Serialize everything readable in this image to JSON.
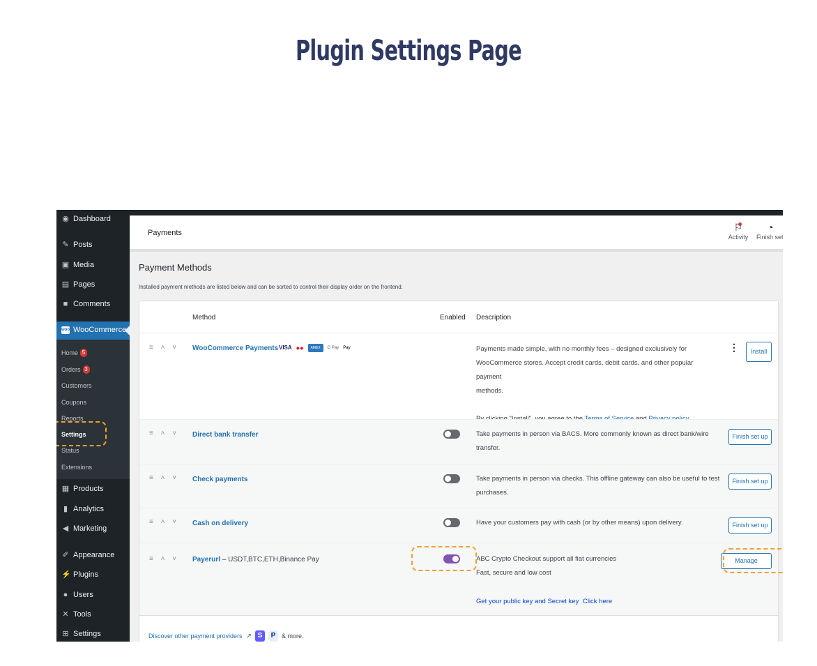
{
  "page_title": "Plugin Settings Page",
  "sidebar": {
    "dashboard": "Dashboard",
    "items": [
      {
        "label": "Posts",
        "icon": "pin-icon"
      },
      {
        "label": "Media",
        "icon": "media-icon"
      },
      {
        "label": "Pages",
        "icon": "pages-icon"
      },
      {
        "label": "Comments",
        "icon": "comments-icon"
      }
    ],
    "woocommerce": "WooCommerce",
    "woo_logo": "woo",
    "woo_sub": [
      {
        "label": "Home",
        "badge": "5"
      },
      {
        "label": "Orders",
        "badge": "3"
      },
      {
        "label": "Customers"
      },
      {
        "label": "Coupons"
      },
      {
        "label": "Reports"
      },
      {
        "label": "Settings",
        "active": true
      },
      {
        "label": "Status"
      },
      {
        "label": "Extensions"
      }
    ],
    "bottom": [
      {
        "label": "Products",
        "icon": "products-icon"
      },
      {
        "label": "Analytics",
        "icon": "analytics-icon"
      },
      {
        "label": "Marketing",
        "icon": "marketing-icon"
      },
      {
        "label": "Appearance",
        "icon": "appearance-icon"
      },
      {
        "label": "Plugins",
        "icon": "plugins-icon"
      },
      {
        "label": "Users",
        "icon": "users-icon"
      },
      {
        "label": "Tools",
        "icon": "tools-icon"
      },
      {
        "label": "Settings",
        "icon": "settings-icon"
      }
    ]
  },
  "header": {
    "breadcrumb": "Payments",
    "activity": "Activity",
    "finish_setup": "Finish setu"
  },
  "payment_methods": {
    "title": "Payment Methods",
    "description": "Installed payment methods are listed below and can be sorted to control their display order on the frontend.",
    "columns": {
      "method": "Method",
      "enabled": "Enabled",
      "description": "Description"
    },
    "rows": [
      {
        "name": "WooCommerce Payments",
        "cards": [
          "VISA",
          "●●",
          "AMEX",
          "G Pay",
          "Pay"
        ],
        "desc_lines": [
          "Payments made simple, with no monthly fees – designed exclusively for",
          "WooCommerce stores. Accept credit cards, debit cards, and other popular payment",
          "methods."
        ],
        "agree_prefix": "By clicking \"Install\", you agree to the",
        "terms": "Terms of Service",
        "and": "and",
        "privacy": "Privacy policy",
        "period": ".",
        "button": "Install"
      },
      {
        "name": "Direct bank transfer",
        "enabled": false,
        "desc_lines": [
          "Take payments in person via BACS. More commonly known as direct bank/wire",
          "transfer."
        ],
        "button": "Finish set up"
      },
      {
        "name": "Check payments",
        "enabled": false,
        "desc_lines": [
          "Take payments in person via checks. This offline gateway can also be useful to test",
          "purchases."
        ],
        "button": "Finish set up"
      },
      {
        "name": "Cash on delivery",
        "enabled": false,
        "desc_lines": [
          "Have your customers pay with cash (or by other means) upon delivery."
        ],
        "button": "Finish set up"
      },
      {
        "name": "Payerurl",
        "subtitle": " – USDT,BTC,ETH,Binance Pay",
        "enabled": true,
        "desc_lines": [
          "ABC Crypto Checkout support all fiat currencies",
          "Fast, secure and low cost"
        ],
        "link_text": "Get your public key and Secret key",
        "link_click": "Click here",
        "button": "Manage"
      }
    ],
    "discover": "Discover other payment providers",
    "discover_more": "& more.",
    "provider_badges": [
      "S",
      "P"
    ]
  },
  "colors": {
    "title": "#2f3a63",
    "accent": "#2271b1",
    "toggle_on": "#7f54b3",
    "highlight": "#f0a030"
  }
}
